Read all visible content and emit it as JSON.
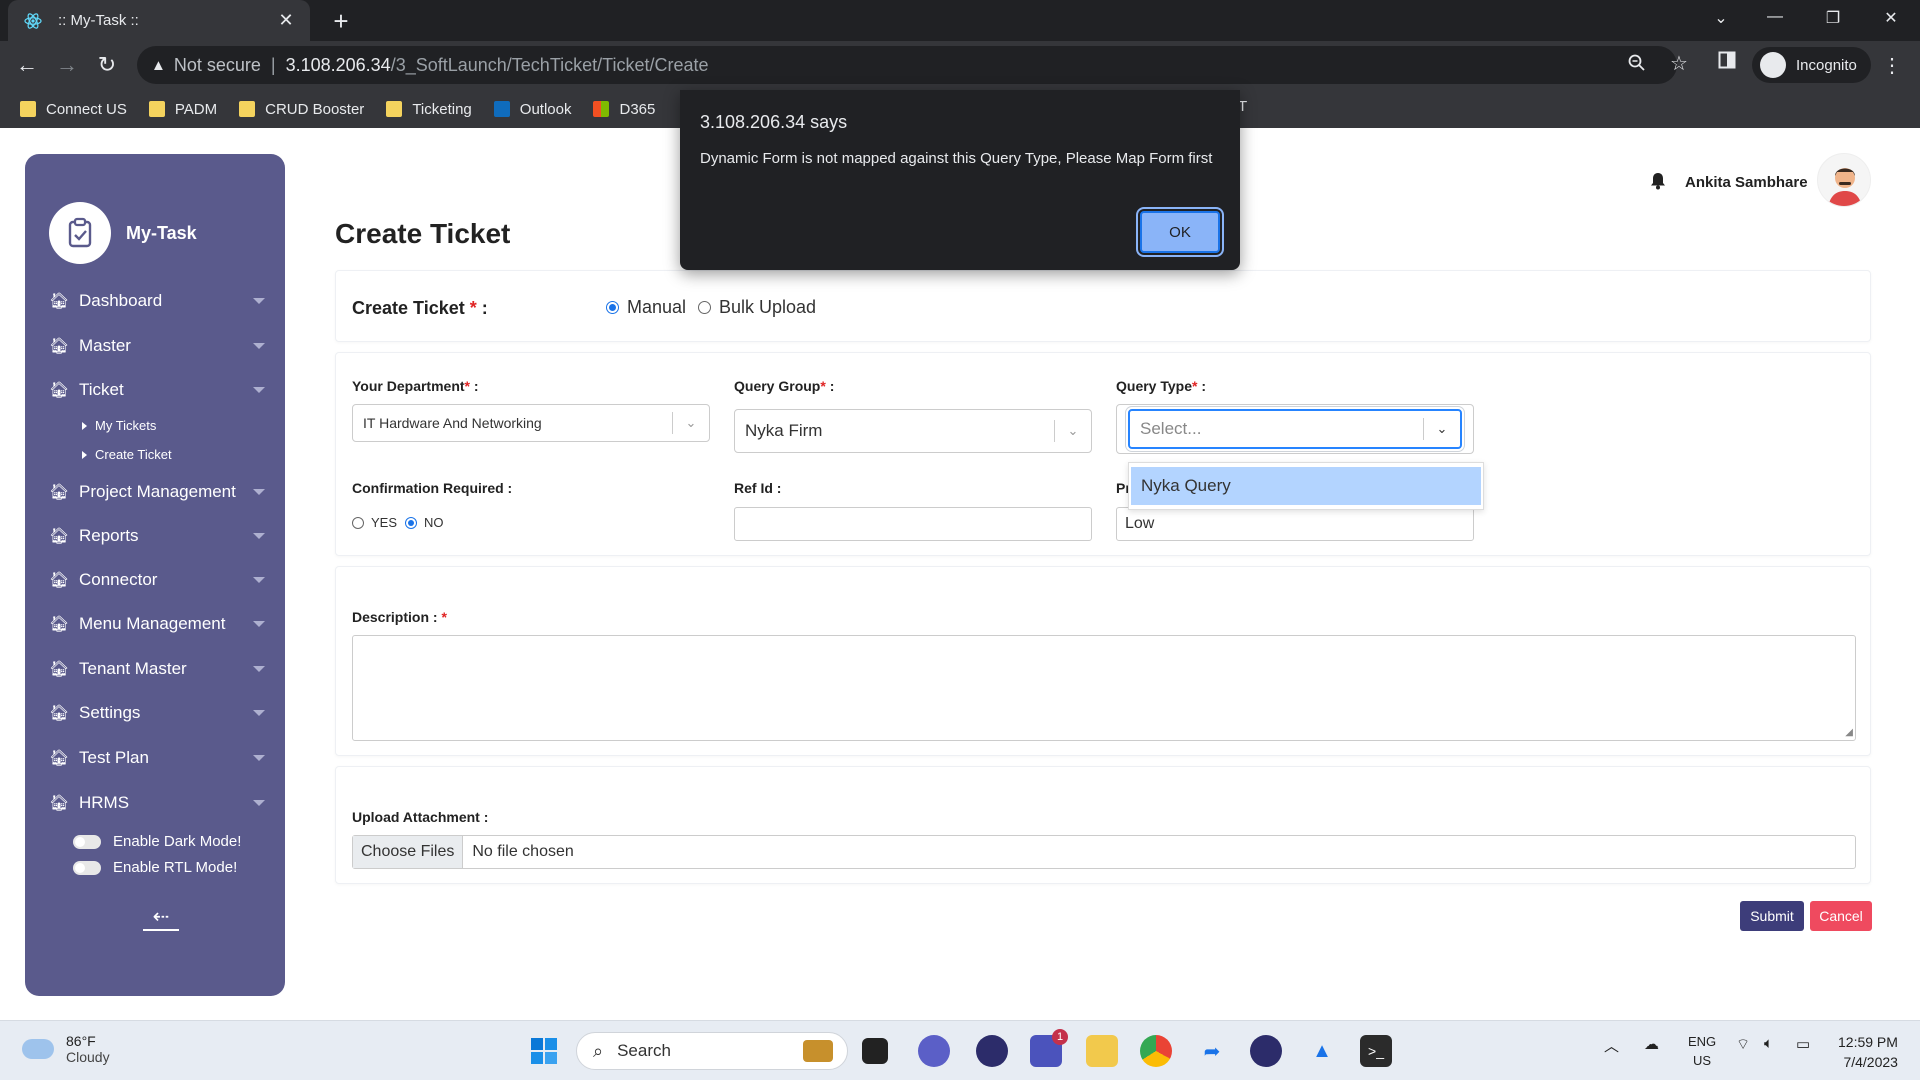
{
  "browser": {
    "tab_title": ":: My-Task ::",
    "close_tab": "✕",
    "new_tab": "+",
    "security": "Not secure",
    "url_host": "3.108.206.34",
    "url_path": "/3_SoftLaunch/TechTicket/Ticket/Create",
    "profile": "Incognito",
    "bookmarks": [
      {
        "label": "Connect US",
        "color": "#f4d35e"
      },
      {
        "label": "PADM",
        "color": "#f4d35e"
      },
      {
        "label": "CRUD Booster",
        "color": "#f4d35e"
      },
      {
        "label": "Ticketing",
        "color": "#f4d35e"
      },
      {
        "label": "Outlook",
        "color": "#0f6cbd"
      },
      {
        "label": "D365",
        "color": "#f25022"
      }
    ],
    "bookmark_tail": "T"
  },
  "alert": {
    "host": "3.108.206.34 says",
    "message": "Dynamic Form is not mapped against this Query Type, Please Map Form first",
    "ok_label": "OK"
  },
  "sidebar": {
    "brand": "My-Task",
    "items": [
      {
        "label": "Dashboard"
      },
      {
        "label": "Master"
      },
      {
        "label": "Ticket"
      },
      {
        "label": "Project Management"
      },
      {
        "label": "Reports"
      },
      {
        "label": "Connector"
      },
      {
        "label": "Menu Management"
      },
      {
        "label": "Tenant Master"
      },
      {
        "label": "Settings"
      },
      {
        "label": "Test Plan"
      },
      {
        "label": "HRMS"
      }
    ],
    "ticket_sub": [
      "My Tickets",
      "Create Ticket"
    ],
    "dark_mode": "Enable Dark Mode!",
    "rtl_mode": "Enable RTL Mode!"
  },
  "header": {
    "user_name": "Ankita Sambhare"
  },
  "page": {
    "title": "Create Ticket",
    "mode_label": "Create Ticket",
    "mode_suffix": " :",
    "mode_options": [
      "Manual",
      "Bulk Upload"
    ],
    "mode_selected": "Manual"
  },
  "form": {
    "department_label": "Your Department",
    "department_value": "IT Hardware And Networking",
    "query_group_label": "Query Group",
    "query_group_value": "Nyka Firm",
    "query_type_label": "Query Type",
    "query_type_placeholder": "Select...",
    "query_type_options": [
      "Nyka Query"
    ],
    "confirmation_label": "Confirmation Required :",
    "confirmation_options": [
      "YES",
      "NO"
    ],
    "confirmation_selected": "NO",
    "ref_id_label": "Ref Id :",
    "ref_id_value": "",
    "priority_label_visible": "Pr",
    "priority_value": "Low",
    "description_label": "Description :",
    "attachment_label": "Upload Attachment :",
    "choose_files": "Choose Files",
    "no_file": "No file chosen",
    "submit": "Submit",
    "cancel": "Cancel"
  },
  "taskbar": {
    "temp": "86°F",
    "weather": "Cloudy",
    "search": "Search",
    "lang_1": "ENG",
    "lang_2": "US",
    "time": "12:59 PM",
    "date": "7/4/2023",
    "teams_badge": "1"
  }
}
